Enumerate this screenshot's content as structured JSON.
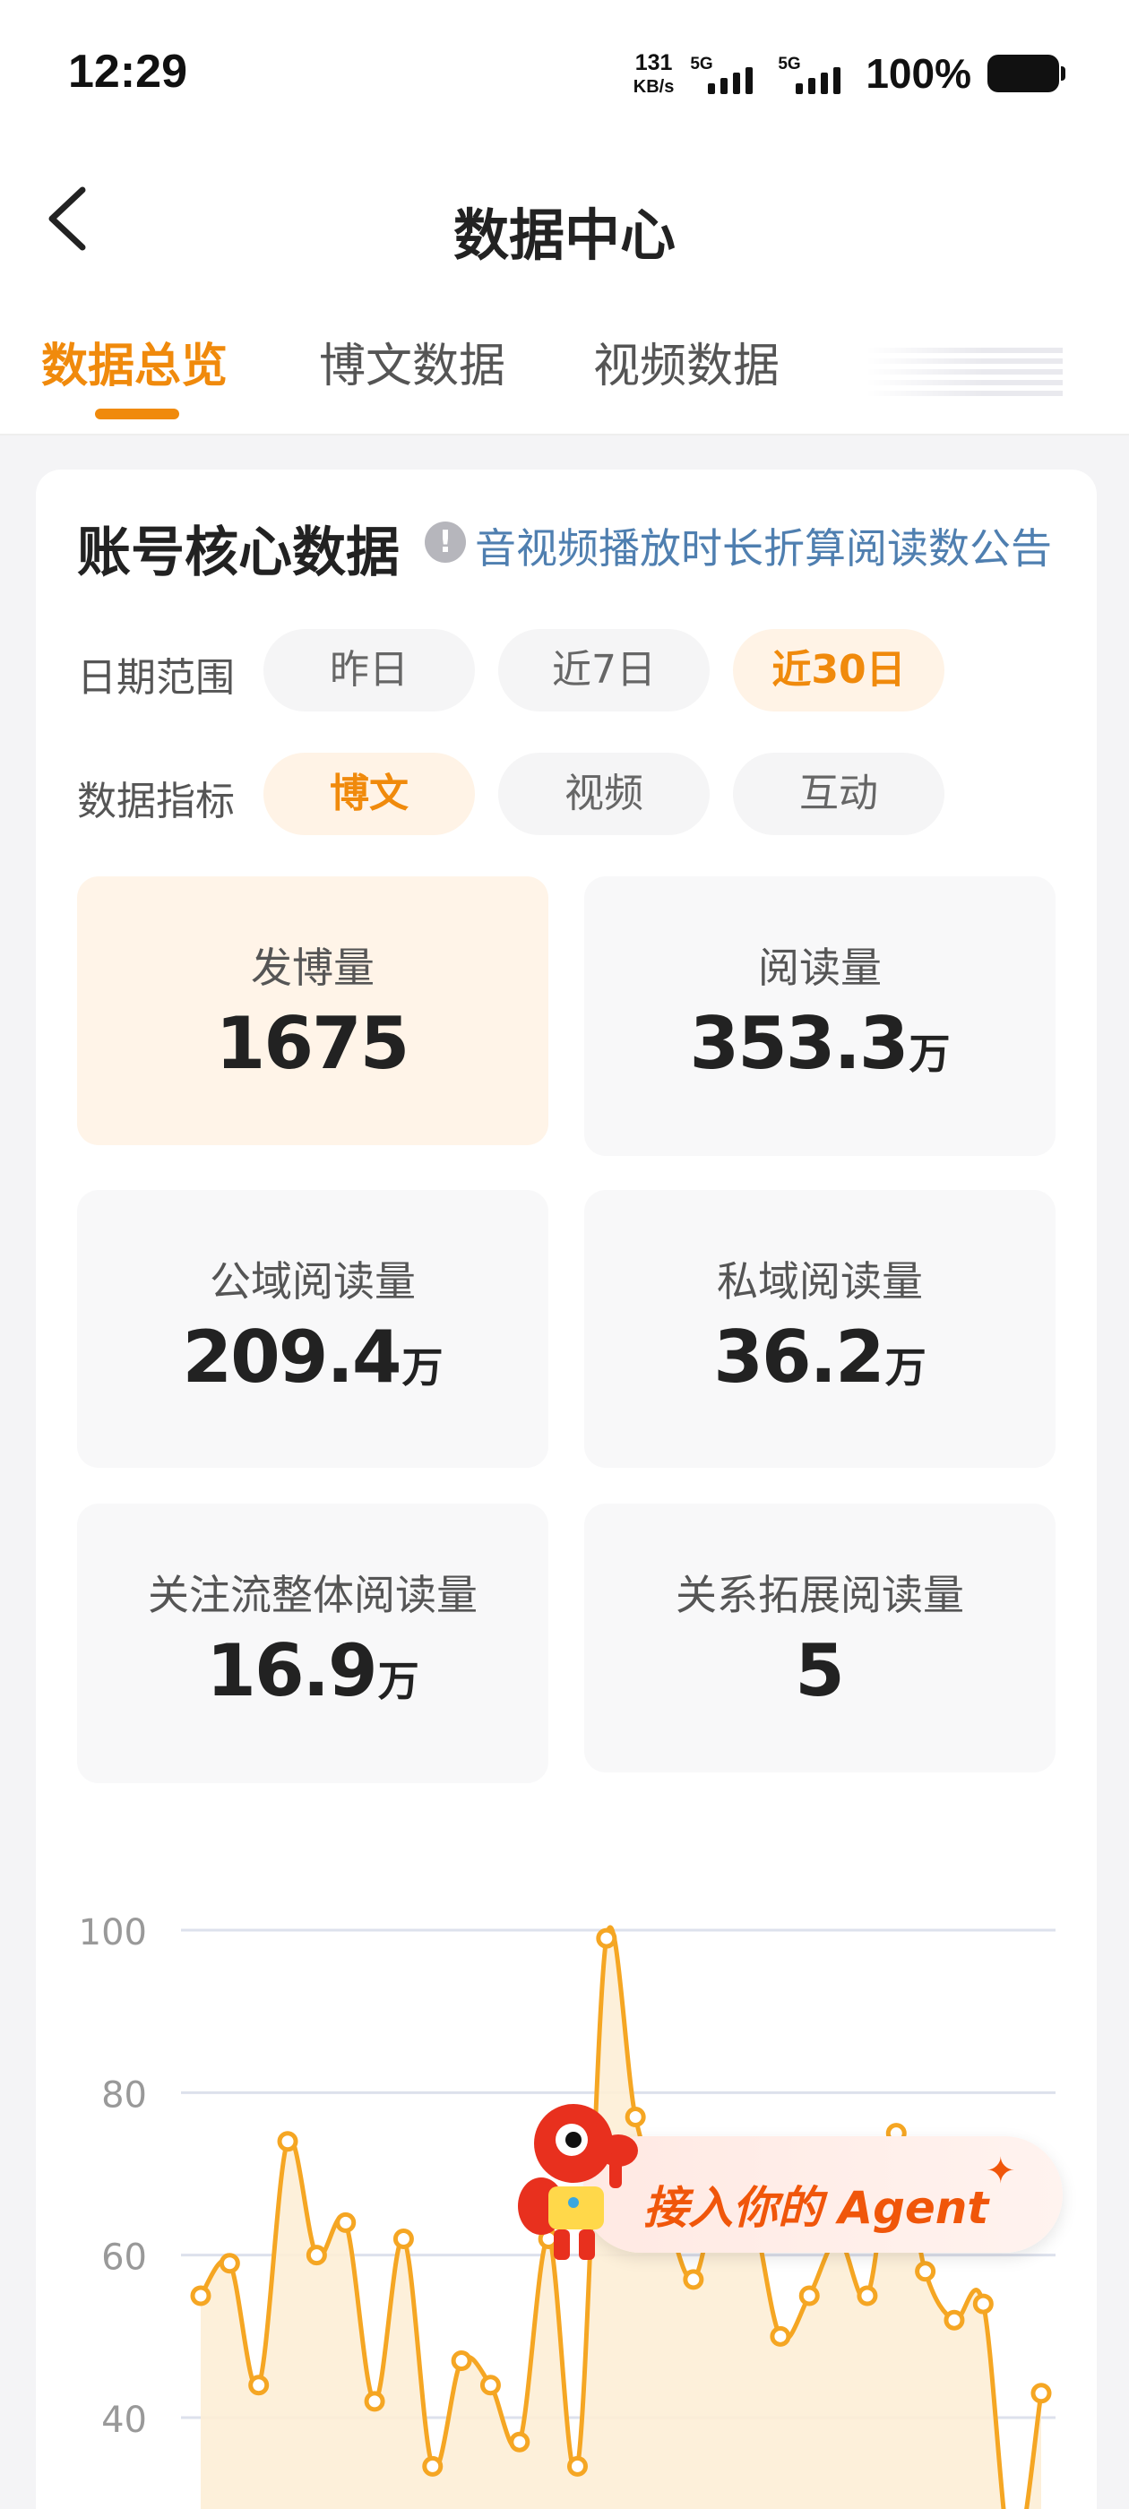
{
  "status_bar": {
    "time": "12:29",
    "net_speed": "131",
    "net_unit": "KB/s",
    "sim1_type": "5G",
    "sim2_type": "5G",
    "battery": "100%"
  },
  "header": {
    "title": "数据中心"
  },
  "tabs": [
    {
      "label": "数据总览",
      "active": true
    },
    {
      "label": "博文数据",
      "active": false
    },
    {
      "label": "视频数据",
      "active": false
    }
  ],
  "card": {
    "title": "账号核心数据",
    "notice": "音视频播放时长折算阅读数公告",
    "date_range": {
      "label": "日期范围",
      "options": [
        "昨日",
        "近7日",
        "近30日"
      ],
      "selected": "近30日"
    },
    "metric": {
      "label": "数据指标",
      "options": [
        "博文",
        "视频",
        "互动"
      ],
      "selected": "博文"
    },
    "stats": [
      {
        "label": "发博量",
        "value": "1675",
        "unit": ""
      },
      {
        "label": "阅读量",
        "value": "353.3",
        "unit": "万"
      },
      {
        "label": "公域阅读量",
        "value": "209.4",
        "unit": "万"
      },
      {
        "label": "私域阅读量",
        "value": "36.2",
        "unit": "万"
      },
      {
        "label": "关注流整体阅读量",
        "value": "16.9",
        "unit": "万"
      },
      {
        "label": "关系拓展阅读量",
        "value": "5",
        "unit": ""
      }
    ]
  },
  "chart_data": {
    "type": "area",
    "x": [
      1,
      2,
      3,
      4,
      5,
      6,
      7,
      8,
      9,
      10,
      11,
      12,
      13,
      14,
      15,
      16,
      17,
      18,
      19,
      20,
      21,
      22,
      23,
      24,
      25,
      26,
      27,
      28,
      29,
      30
    ],
    "series": [
      {
        "values": [
          55,
          59,
          44,
          74,
          60,
          64,
          42,
          62,
          34,
          47,
          44,
          37,
          62,
          34,
          99,
          77,
          66,
          57,
          70,
          66,
          50,
          55,
          62,
          55,
          75,
          58,
          52,
          54,
          22,
          43
        ]
      }
    ],
    "yticks": [
      40,
      60,
      80,
      100
    ],
    "ylim": [
      25,
      108
    ],
    "grid": true,
    "color": "#f5a623"
  },
  "agent_badge": {
    "text": "接入你的 Agent"
  },
  "colors": {
    "accent": "#f08a0c",
    "link": "#4f7fb0"
  }
}
